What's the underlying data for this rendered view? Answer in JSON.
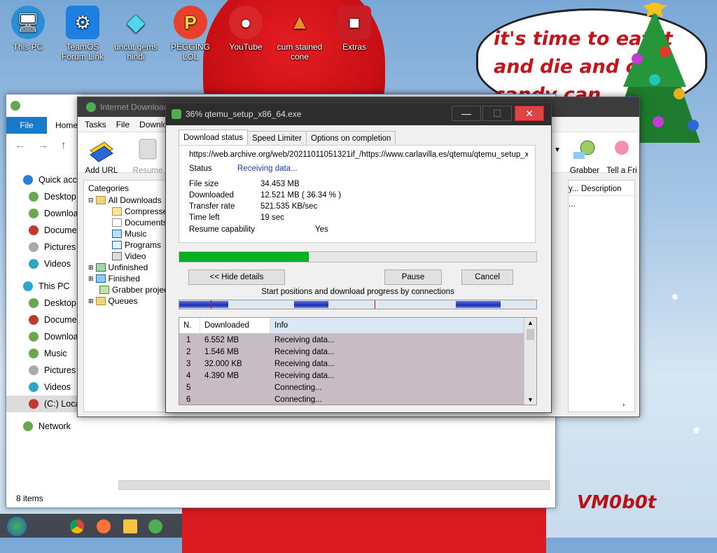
{
  "desktop": {
    "icons": [
      {
        "label": "This PC"
      },
      {
        "label": "TeamOS Forum Link"
      },
      {
        "label": "uncut gems hindi"
      },
      {
        "label": "PEGGING LOL"
      },
      {
        "label": "YouTube"
      },
      {
        "label": "cum stained cone"
      },
      {
        "label": "Extras"
      }
    ],
    "speech_bubble": "it's time to eat it and die and c candy can",
    "watermark": "VM0b0t"
  },
  "explorer": {
    "tab_file": "File",
    "tab_home": "Home",
    "sidebar": [
      {
        "label": "Quick acce"
      },
      {
        "label": "Desktop"
      },
      {
        "label": "Downloa"
      },
      {
        "label": "Documen"
      },
      {
        "label": "Pictures"
      },
      {
        "label": "Videos"
      },
      {
        "label": "This PC"
      },
      {
        "label": "Desktop"
      },
      {
        "label": "Documen"
      },
      {
        "label": "Downloa"
      },
      {
        "label": "Music"
      },
      {
        "label": "Pictures"
      },
      {
        "label": "Videos"
      },
      {
        "label": "(C:) Loca"
      },
      {
        "label": "Network"
      }
    ],
    "status": "8 items"
  },
  "idm": {
    "title": "Internet Download",
    "menu": [
      "Tasks",
      "File",
      "Downlo"
    ],
    "toolbar": {
      "add_url": "Add URL",
      "resume": "Resume",
      "grabber": "Grabber",
      "tell": "Tell a Fri"
    },
    "categories_header": "Categories",
    "categories": [
      {
        "label": "All Downloads"
      },
      {
        "label": "Compresse"
      },
      {
        "label": "Documents"
      },
      {
        "label": "Music"
      },
      {
        "label": "Programs"
      },
      {
        "label": "Video"
      },
      {
        "label": "Unfinished"
      },
      {
        "label": "Finished"
      },
      {
        "label": "Grabber projec"
      },
      {
        "label": "Queues"
      }
    ],
    "list_col_description": "Description",
    "list_col_partial": "y...",
    "list_cell_partial": "..."
  },
  "dialog": {
    "title": "36% qtemu_setup_x86_64.exe",
    "tabs": [
      "Download status",
      "Speed Limiter",
      "Options on completion"
    ],
    "url": "https://web.archive.org/web/20211011051321if_/https://www.carlavilla.es/qtemu/qtemu_setup_x8",
    "status_label": "Status",
    "status_value": "Receiving data...",
    "fields": [
      {
        "k": "File size",
        "v": "34.453  MB"
      },
      {
        "k": "Downloaded",
        "v": "12.521  MB  ( 36.34 % )"
      },
      {
        "k": "Transfer rate",
        "v": "521.535  KB/sec"
      },
      {
        "k": "Time left",
        "v": "19 sec"
      }
    ],
    "resume_label": "Resume capability",
    "resume_value": "Yes",
    "progress_fraction": 0.3634,
    "buttons": {
      "hide_details": "<< Hide details",
      "pause": "Pause",
      "cancel": "Cancel"
    },
    "connections_label": "Start positions and download progress by connections",
    "table": {
      "headers": [
        "N.",
        "Downloaded",
        "Info"
      ],
      "rows": [
        [
          "1",
          "6.552  MB",
          "Receiving data..."
        ],
        [
          "2",
          "1.546  MB",
          "Receiving data..."
        ],
        [
          "3",
          "32.000  KB",
          "Receiving data..."
        ],
        [
          "4",
          "4.390  MB",
          "Receiving data..."
        ],
        [
          "5",
          "",
          "Connecting..."
        ],
        [
          "6",
          "",
          "Connecting..."
        ]
      ]
    }
  },
  "colors": {
    "progress": "#06b025",
    "accent": "#1979ca",
    "title_bar": "#2d2d2d"
  }
}
